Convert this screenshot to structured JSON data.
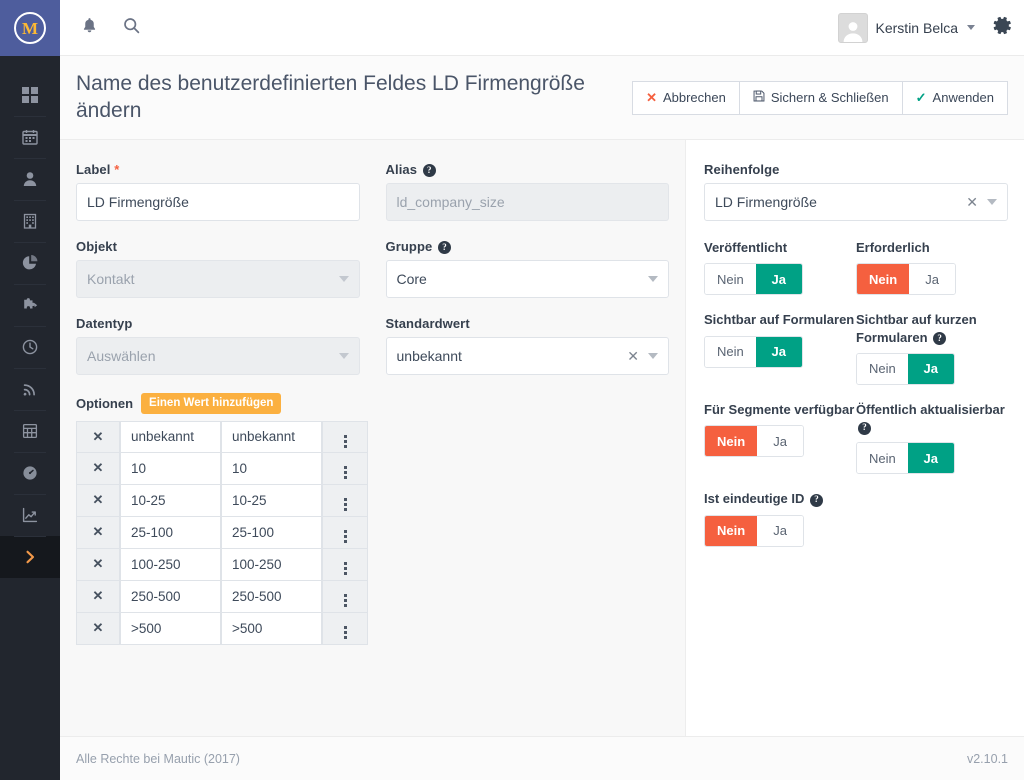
{
  "app": {
    "logo_letter": "M",
    "footer_copyright": "Alle Rechte bei Mautic (2017)",
    "footer_version": "v2.10.1"
  },
  "topbar": {
    "notifications_icon": "bell-icon",
    "search_icon": "search-icon",
    "user_name": "Kerstin Belca",
    "settings_icon": "gear-icon"
  },
  "sidebar": {
    "items": [
      {
        "icon": "dashboard-grid-icon",
        "name": "dashboard"
      },
      {
        "icon": "calendar-icon",
        "name": "calendar"
      },
      {
        "icon": "contacts-person-icon",
        "name": "contacts"
      },
      {
        "icon": "companies-building-icon",
        "name": "companies"
      },
      {
        "icon": "segments-pie-chart-icon",
        "name": "segments"
      },
      {
        "icon": "campaigns-puzzle-icon",
        "name": "campaigns"
      },
      {
        "icon": "points-clock-icon",
        "name": "points"
      },
      {
        "icon": "channels-rss-icon",
        "name": "channels"
      },
      {
        "icon": "components-table-icon",
        "name": "components"
      },
      {
        "icon": "stages-gauge-icon",
        "name": "stages"
      },
      {
        "icon": "reports-line-chart-icon",
        "name": "reports"
      },
      {
        "icon": "expand-chevron-right-icon",
        "name": "expand-menu"
      }
    ]
  },
  "header": {
    "title": "Name des benutzerdefinierten Feldes LD Firmengröße ändern",
    "buttons": [
      {
        "label": "Abbrechen",
        "icon": "close-x-icon",
        "name": "cancel-button"
      },
      {
        "label": "Sichern & Schließen",
        "icon": "save-disk-icon",
        "name": "save-and-close-button"
      },
      {
        "label": "Anwenden",
        "icon": "check-icon",
        "name": "apply-button"
      }
    ]
  },
  "form": {
    "label_field": {
      "label": "Label",
      "required_marker": "*",
      "value": "LD Firmengröße"
    },
    "alias_field": {
      "label": "Alias",
      "has_help": true,
      "value": "ld_company_size",
      "disabled": true
    },
    "object_field": {
      "label": "Objekt",
      "value": "Kontakt",
      "disabled": true
    },
    "group_field": {
      "label": "Gruppe",
      "has_help": true,
      "value": "Core"
    },
    "datatype_field": {
      "label": "Datentyp",
      "value": "Auswählen",
      "disabled": true
    },
    "default_value_field": {
      "label": "Standardwert",
      "value": "unbekannt",
      "clear_icon": "clear-x-icon"
    },
    "options": {
      "label": "Optionen",
      "add_button_label": "Einen Wert hinzufügen",
      "rows": [
        {
          "delete_icon": "delete-x-icon",
          "label": "unbekannt",
          "value": "unbekannt",
          "drag_icon": "drag-dots-icon"
        },
        {
          "delete_icon": "delete-x-icon",
          "label": "10",
          "value": "10",
          "drag_icon": "drag-dots-icon"
        },
        {
          "delete_icon": "delete-x-icon",
          "label": "10-25",
          "value": "10-25",
          "drag_icon": "drag-dots-icon"
        },
        {
          "delete_icon": "delete-x-icon",
          "label": "25-100",
          "value": "25-100",
          "drag_icon": "drag-dots-icon"
        },
        {
          "delete_icon": "delete-x-icon",
          "label": "100-250",
          "value": "100-250",
          "drag_icon": "drag-dots-icon"
        },
        {
          "delete_icon": "delete-x-icon",
          "label": "250-500",
          "value": "250-500",
          "drag_icon": "drag-dots-icon"
        },
        {
          "delete_icon": "delete-x-icon",
          "label": ">500",
          "value": ">500",
          "drag_icon": "drag-dots-icon"
        }
      ]
    }
  },
  "panel": {
    "order_field": {
      "label": "Reihenfolge",
      "value": "LD Firmengröße",
      "clear_icon": "clear-x-icon"
    },
    "toggles": [
      {
        "name": "published",
        "label": "Veröffentlicht",
        "has_help": false,
        "no_label": "Nein",
        "yes_label": "Ja",
        "selected": "yes"
      },
      {
        "name": "required",
        "label": "Erforderlich",
        "has_help": false,
        "no_label": "Nein",
        "yes_label": "Ja",
        "selected": "no"
      },
      {
        "name": "visible-on-forms",
        "label": "Sichtbar auf Formularen",
        "has_help": false,
        "no_label": "Nein",
        "yes_label": "Ja",
        "selected": "yes"
      },
      {
        "name": "visible-short-forms",
        "label": "Sichtbar auf kurzen Formularen",
        "has_help": true,
        "no_label": "Nein",
        "yes_label": "Ja",
        "selected": "yes"
      },
      {
        "name": "available-segments",
        "label": "Für Segmente verfügbar",
        "has_help": false,
        "no_label": "Nein",
        "yes_label": "Ja",
        "selected": "no"
      },
      {
        "name": "publicly-updatable",
        "label": "Öffentlich aktualisierbar",
        "has_help": true,
        "no_label": "Nein",
        "yes_label": "Ja",
        "selected": "yes"
      },
      {
        "name": "is-unique-id",
        "label": "Ist eindeutige ID",
        "has_help": true,
        "no_label": "Nein",
        "yes_label": "Ja",
        "selected": "no"
      }
    ]
  },
  "colors": {
    "brand_blue": "#4e5d9d",
    "sidebar_dark": "#22262e",
    "accent_orange": "#f2994a",
    "toggle_yes_green": "#00a185",
    "toggle_no_red": "#f5603f",
    "badge_amber": "#fbb040",
    "logo_gold": "#fdb933"
  }
}
